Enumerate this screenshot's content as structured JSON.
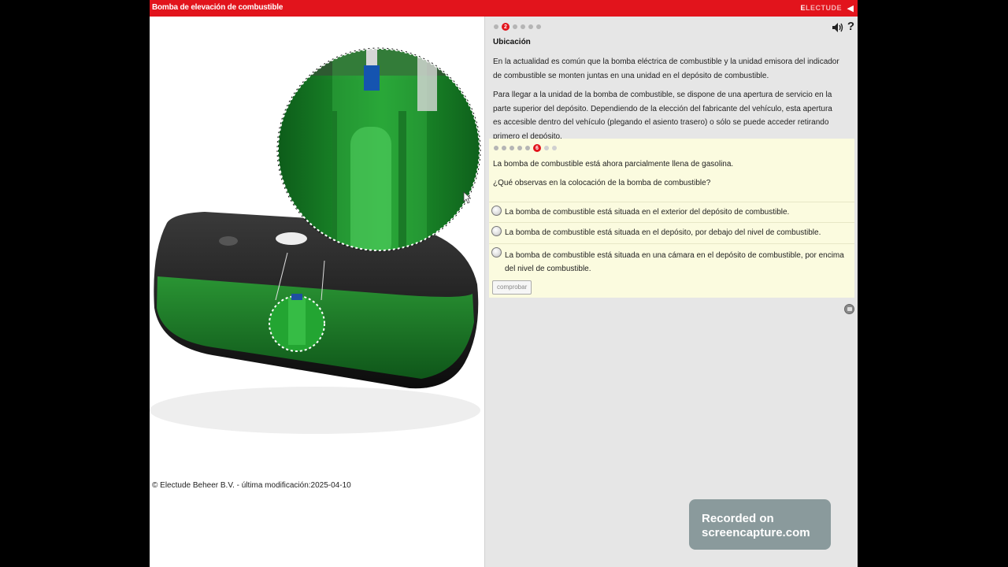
{
  "titlebar": {
    "title": "Bomba de elevación de combustible",
    "brand_first": "E",
    "brand_rest": "LECTUDE",
    "collapse_icon": "chevron-left-icon"
  },
  "left": {
    "copyright": "© Electude Beheer B.V. - última modificación:2025-04-10"
  },
  "right": {
    "page_dots": {
      "total": 6,
      "current_label": "2"
    },
    "section_title": "Ubicación",
    "paragraph1": "En la actualidad es común que la bomba eléctrica de combustible y la unidad emisora del indicador de combustible se monten juntas en una unidad en el depósito de combustible.",
    "paragraph2": "Para llegar a la unidad de la bomba de combustible, se dispone de una apertura de servicio en la parte superior del depósito. Dependiendo de la elección del fabricante del vehículo, esta apertura es accesible dentro del vehículo (plegando el asiento trasero) o sólo se puede acceder retirando primero el depósito.",
    "help_label": "?"
  },
  "quiz": {
    "dots": {
      "total": 8,
      "current_label": "6"
    },
    "statement": "La bomba de combustible está ahora parcialmente llena de gasolina.",
    "question": "¿Qué observas en la colocación de la bomba de combustible?",
    "options": [
      {
        "label": "La bomba de combustible está situada en el exterior del depósito de combustible."
      },
      {
        "label": "La bomba de combustible está situada en el depósito, por debajo del nivel de combustible."
      },
      {
        "label": "La bomba de combustible está situada en una cámara en el depósito de combustible, por encima del nivel de combustible."
      }
    ],
    "check_label": "comprobar"
  },
  "overlay": {
    "line1": "Recorded on",
    "line2": "screencapture.com"
  },
  "colors": {
    "accent": "#e2141c",
    "quiz_bg": "#fbfbdf",
    "panel_bg": "#e6e6e6",
    "fuel_green": "#1f8f2f",
    "tank_black": "#1a1a1a"
  }
}
